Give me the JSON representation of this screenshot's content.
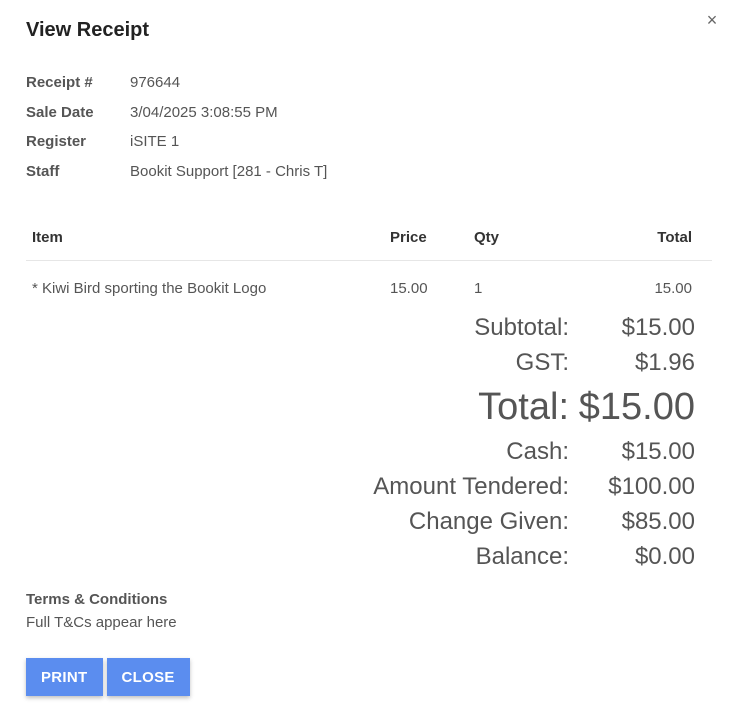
{
  "dialog": {
    "title": "View Receipt",
    "close_icon": "×"
  },
  "meta": [
    {
      "label": "Receipt #",
      "value": "976644"
    },
    {
      "label": "Sale Date",
      "value": "3/04/2025 3:08:55 PM"
    },
    {
      "label": "Register",
      "value": "iSITE 1"
    },
    {
      "label": "Staff",
      "value": "Bookit Support [281 - Chris T]"
    }
  ],
  "items": {
    "headers": {
      "item": "Item",
      "price": "Price",
      "qty": "Qty",
      "total": "Total"
    },
    "rows": [
      {
        "item": "* Kiwi Bird sporting the Bookit Logo",
        "price": "15.00",
        "qty": "1",
        "total": "15.00"
      }
    ]
  },
  "totals": {
    "subtotal_label": "Subtotal:",
    "subtotal_value": "$15.00",
    "gst_label": "GST:",
    "gst_value": "$1.96",
    "total_label": "Total:",
    "total_value": "$15.00",
    "cash_label": "Cash:",
    "cash_value": "$15.00",
    "tendered_label": "Amount Tendered:",
    "tendered_value": "$100.00",
    "change_label": "Change Given:",
    "change_value": "$85.00",
    "balance_label": "Balance:",
    "balance_value": "$0.00"
  },
  "terms": {
    "title": "Terms & Conditions",
    "body": "Full T&Cs appear here"
  },
  "buttons": {
    "print_label": "PRINT",
    "close_label": "CLOSE"
  },
  "colors": {
    "button_bg": "#5b8def",
    "text": "#555555",
    "title": "#222222"
  }
}
